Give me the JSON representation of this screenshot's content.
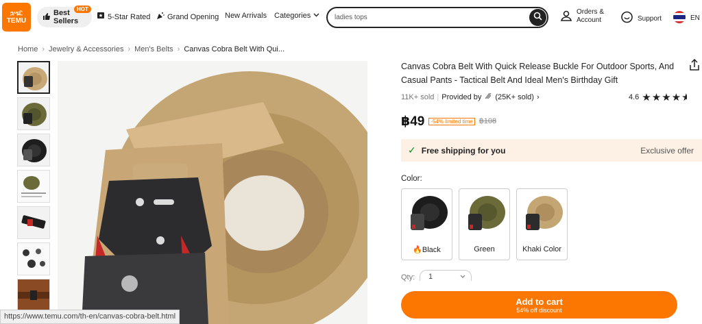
{
  "header": {
    "logo_glyphs": "ኋሤᏝ",
    "logo_text": "TEMU",
    "nav": {
      "best_sellers": "Best Sellers",
      "hot_badge": "HOT",
      "five_star": "5-Star Rated",
      "grand_opening": "Grand Opening",
      "new_arrivals": "New Arrivals",
      "categories": "Categories"
    },
    "search": {
      "value": "ladies tops"
    },
    "orders_line1": "Orders &",
    "orders_line2": "Account",
    "support": "Support",
    "language": "EN"
  },
  "breadcrumb": [
    "Home",
    "Jewelry & Accessories",
    "Men's Belts",
    "Canvas Cobra Belt With Qui..."
  ],
  "product": {
    "title": "Canvas Cobra Belt With Quick Release Buckle For Outdoor Sports, And Casual Pants - Tactical Belt And Ideal Men's Birthday Gift",
    "sold": "11K+ sold",
    "provided_by": "Provided by",
    "seller_sold": "(25K+ sold)",
    "rating": "4.6",
    "rating_value": 4.6,
    "price": "฿49",
    "discount_badge": "-54% limited time",
    "old_price": "฿108",
    "shipping": "Free shipping for you",
    "exclusive": "Exclusive offer",
    "color_label": "Color:",
    "colors": [
      "Black",
      "Green",
      "Khaki Color"
    ],
    "qty_label": "Qty:",
    "qty_value": "1",
    "cart_label": "Add to cart",
    "cart_sub": "54% off discount"
  },
  "status_url": "https://www.temu.com/th-en/canvas-cobra-belt.html",
  "colors": {
    "accent": "#fb7701",
    "ship_bg": "#fdf1e6",
    "check": "#0a8a1f"
  }
}
